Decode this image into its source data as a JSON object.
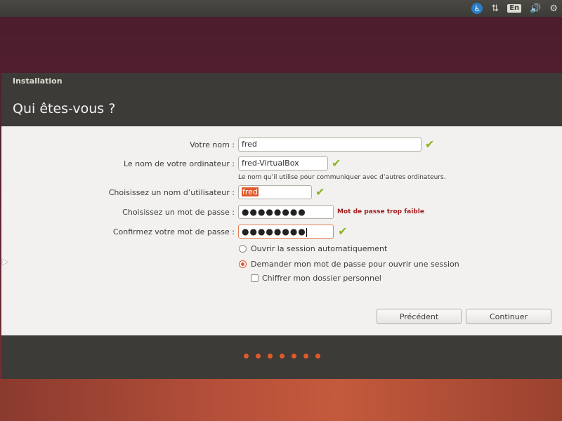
{
  "top_panel": {
    "accessibility_glyph": "♿",
    "network_glyph": "⇅",
    "language": "En",
    "volume_glyph": "🔊",
    "settings_glyph": "⚙"
  },
  "window": {
    "title": "Installation",
    "heading": "Qui êtes-vous ?"
  },
  "form": {
    "name_label": "Votre nom :",
    "name_value": "fred",
    "computer_label": "Le nom de votre ordinateur :",
    "computer_value": "fred-VirtualBox",
    "computer_hint": "Le nom qu’il utilise pour communiquer avec d’autres ordinateurs.",
    "username_label": "Choisissez un nom d’utilisateur :",
    "username_value": "fred",
    "password_label": "Choisissez un mot de passe :",
    "password_value": "●●●●●●●●",
    "password_strength": "Mot de passe trop faible",
    "confirm_label": "Confirmez votre mot de passe :",
    "confirm_value": "●●●●●●●●",
    "check_glyph": "✔"
  },
  "options": {
    "auto_login": "Ouvrir la session automatiquement",
    "ask_password": "Demander mon mot de passe pour ouvrir une session",
    "encrypt_home": "Chiffrer mon dossier personnel",
    "selected": "ask_password",
    "encrypt_checked": false
  },
  "buttons": {
    "back": "Précédent",
    "continue": "Continuer"
  },
  "progress": {
    "steps_total": 7
  },
  "colors": {
    "accent": "#e05a2b",
    "check": "#8ab41b",
    "warning": "#a11d1d",
    "panel": "#3c3b37"
  }
}
